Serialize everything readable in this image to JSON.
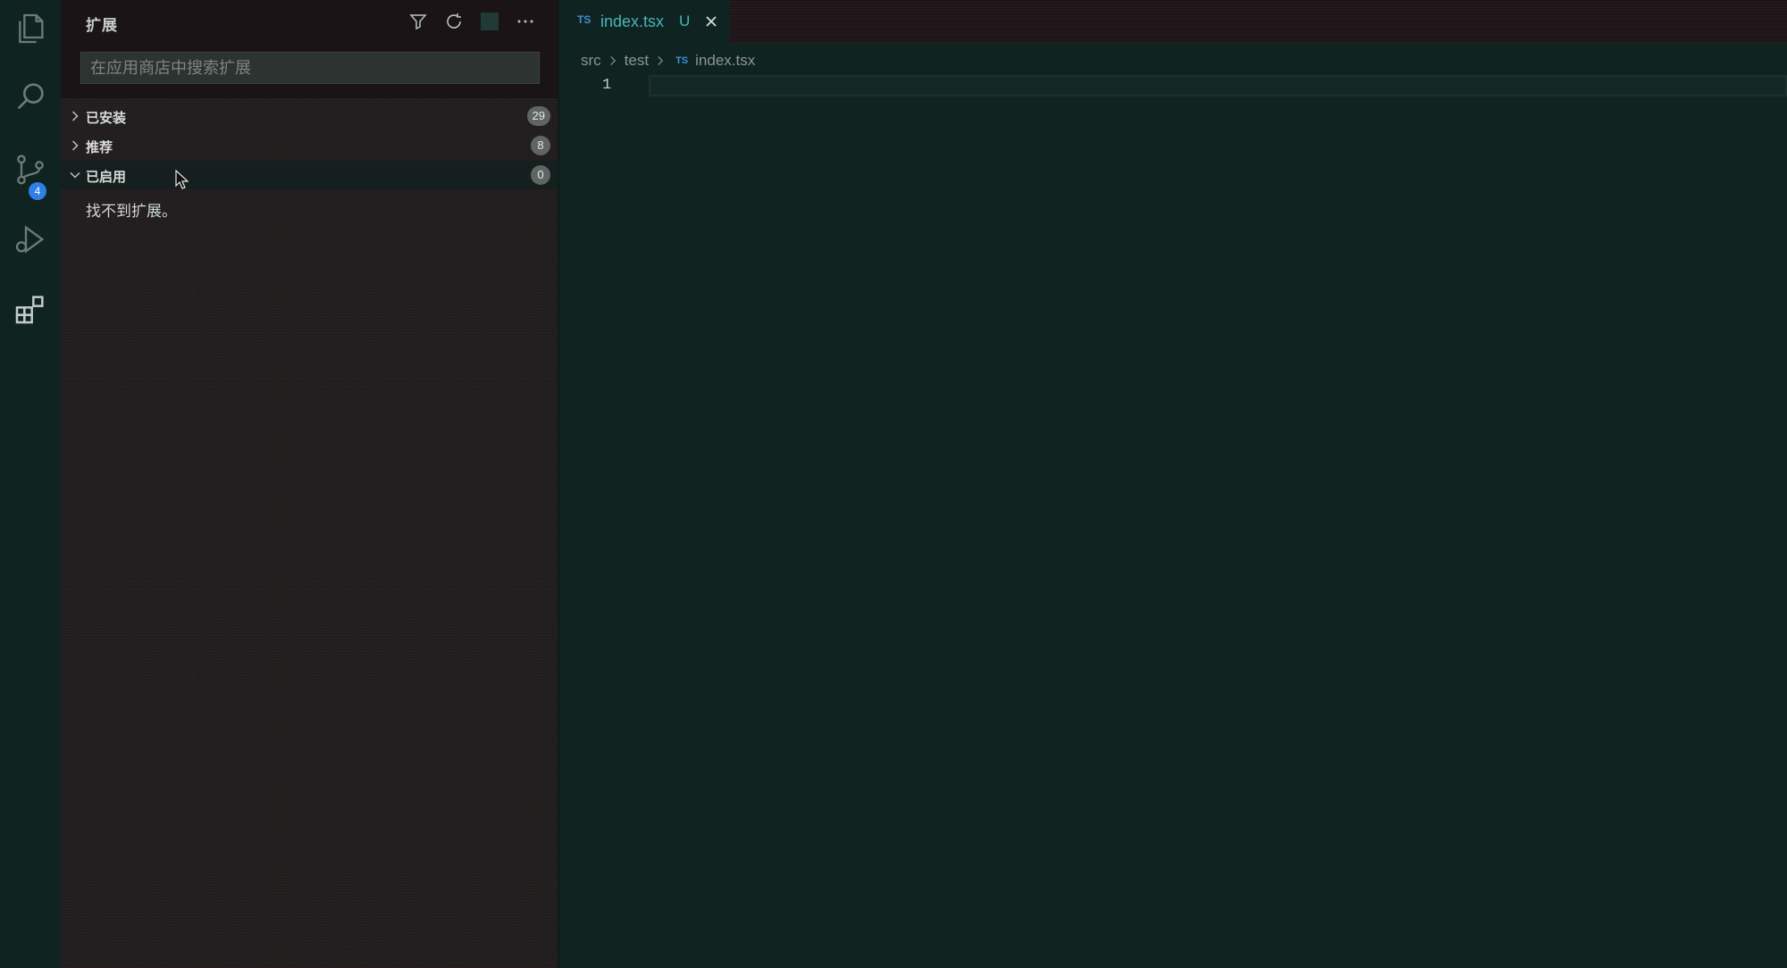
{
  "activity_bar": {
    "items": [
      {
        "name": "explorer",
        "icon": "files-icon"
      },
      {
        "name": "search",
        "icon": "search-icon"
      },
      {
        "name": "source-control",
        "icon": "source-control-icon",
        "badge": "4"
      },
      {
        "name": "run-debug",
        "icon": "run-debug-icon"
      },
      {
        "name": "extensions",
        "icon": "extensions-icon"
      }
    ]
  },
  "sidebar": {
    "title": "扩展",
    "actions": [
      "filter-icon",
      "refresh-icon",
      "views-icon",
      "more-icon"
    ],
    "search": {
      "placeholder": "在应用商店中搜索扩展",
      "value": ""
    },
    "sections": [
      {
        "label": "已安装",
        "count": "29",
        "expanded": false
      },
      {
        "label": "推荐",
        "count": "8",
        "expanded": false
      },
      {
        "label": "已启用",
        "count": "0",
        "expanded": true
      }
    ],
    "empty_message": "找不到扩展。"
  },
  "editor": {
    "tab": {
      "icon": "TS",
      "name": "index.tsx",
      "status": "U"
    },
    "breadcrumb": [
      "src",
      "test",
      "index.tsx"
    ],
    "breadcrumb_file_icon": "TS",
    "line_number": "1"
  },
  "colors": {
    "background": "#0f2421",
    "accent": "#48b4bd",
    "badge": "#2f7fe6"
  }
}
